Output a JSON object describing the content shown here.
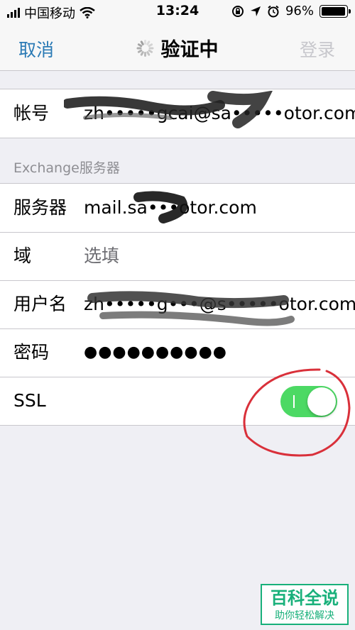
{
  "status_bar": {
    "carrier": "中国移动",
    "time": "13:24",
    "battery_percent": "96%",
    "battery_level": 0.96
  },
  "nav": {
    "cancel_label": "取消",
    "title": "验证中",
    "login_label": "登录"
  },
  "account": {
    "label": "帐号",
    "value": "zh•••••gcai@sa•••••otor.com"
  },
  "exchange": {
    "section_header": "Exchange服务器",
    "rows": [
      {
        "label": "服务器",
        "value": "mail.sa•••otor.com"
      },
      {
        "label": "域",
        "value": "选填"
      },
      {
        "label": "用户名",
        "value": "zh•••••g•••@s•••••otor.com"
      },
      {
        "label": "密码",
        "value": "●●●●●●●●●●"
      },
      {
        "label": "SSL",
        "toggle_on": true
      }
    ]
  },
  "watermark": {
    "top": "百科全说",
    "bottom": "助你轻松解决"
  },
  "colors": {
    "accent_blue": "#2a7ab5",
    "toggle_green": "#4cd964",
    "annotation_red": "#d9303a",
    "watermark_green": "#18b07a"
  }
}
